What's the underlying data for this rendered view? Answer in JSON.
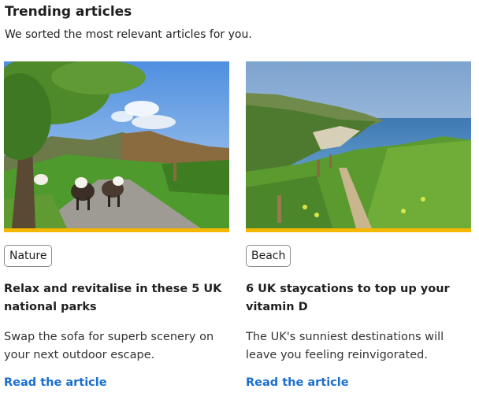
{
  "section": {
    "title": "Trending articles",
    "subtitle": "We sorted the most relevant articles for you."
  },
  "articles": [
    {
      "tag": "Nature",
      "headline": "Relax and revitalise in these 5 UK national parks",
      "summary": "Swap the sofa for superb scenery on your next outdoor escape.",
      "link_label": "Read the article"
    },
    {
      "tag": "Beach",
      "headline": "6 UK staycations to top up your vitamin D",
      "summary": "The UK's sunniest destinations will leave you feeling reinvigorated.",
      "link_label": "Read the article"
    }
  ],
  "colors": {
    "accent": "#f5b800",
    "link": "#1a6fcf"
  }
}
